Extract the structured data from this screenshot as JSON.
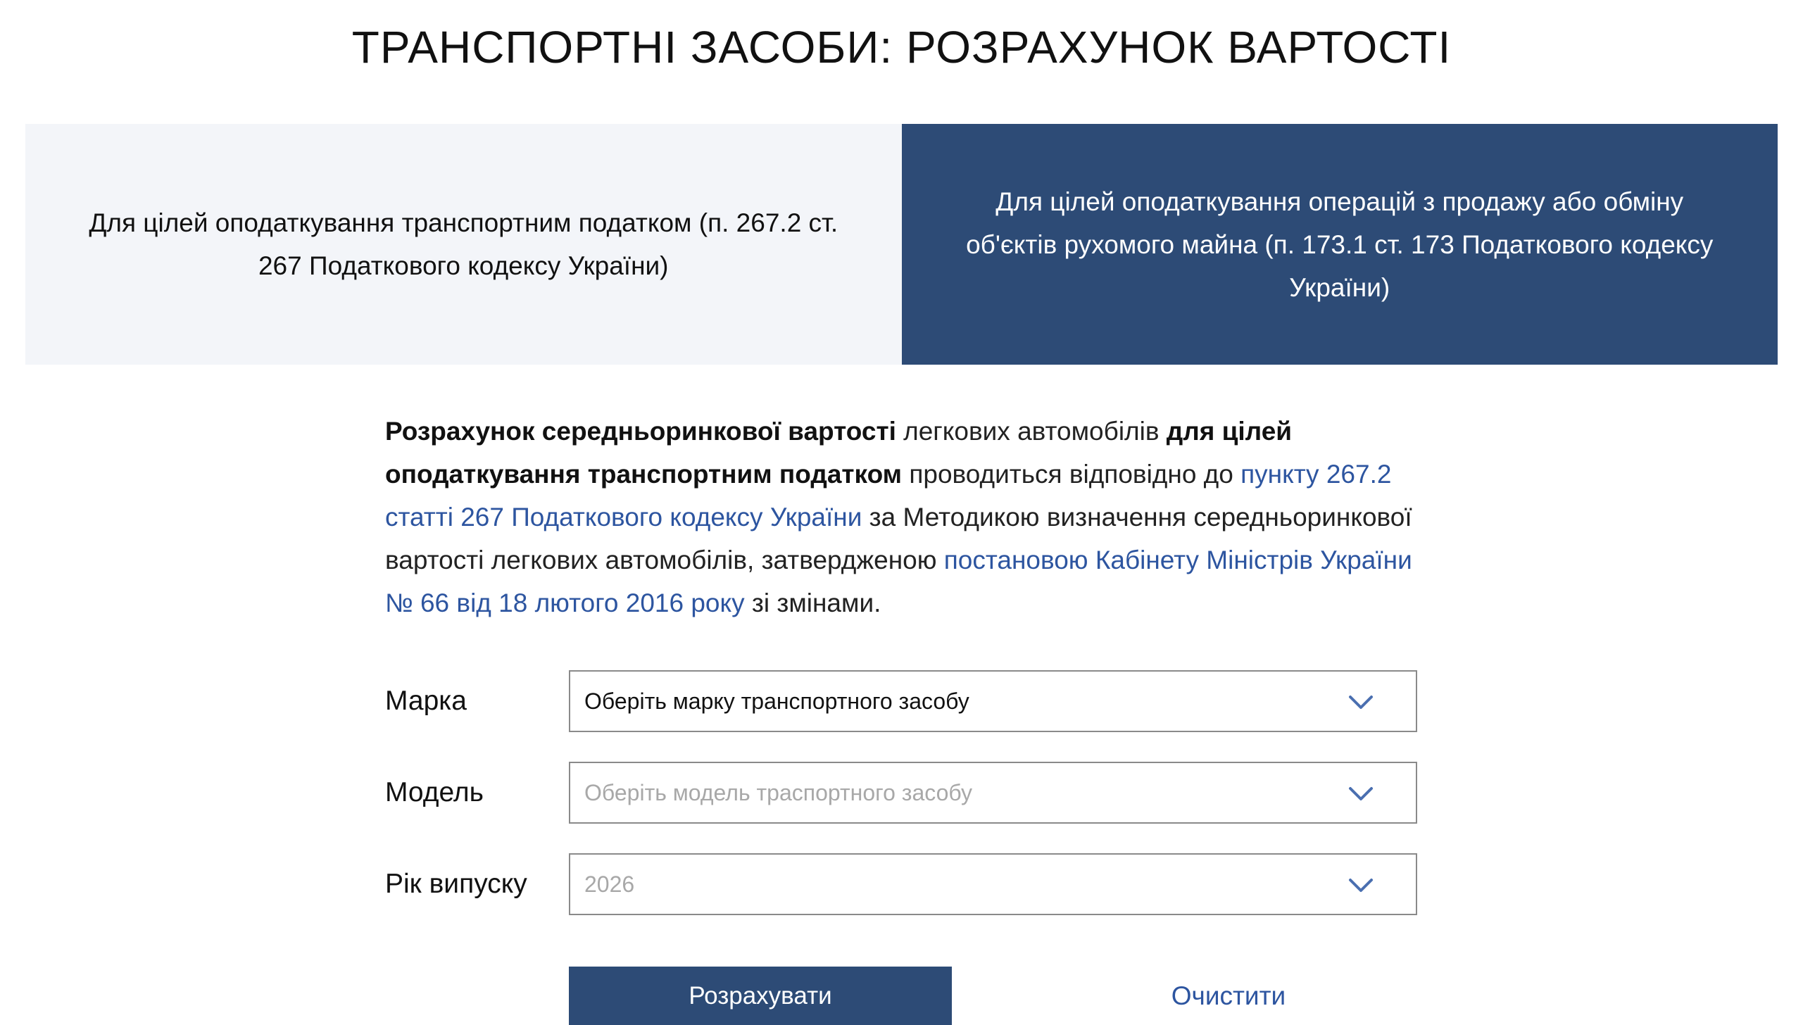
{
  "page": {
    "title": "ТРАНСПОРТНІ ЗАСОБИ: РОЗРАХУНОК ВАРТОСТІ"
  },
  "tabs": [
    {
      "label": "Для цілей оподаткування транспортним податком (п. 267.2 ст. 267 Податкового кодексу України)",
      "active": false
    },
    {
      "label": "Для цілей оподаткування операцій з продажу або обміну об'єктів рухомого майна (п. 173.1 ст. 173 Податкового кодексу України)",
      "active": true
    }
  ],
  "intro": {
    "bold_1": "Розрахунок середньоринкової вартості",
    "text_1": " легкових автомобілів ",
    "bold_2": "для цілей оподаткування транспортним податком",
    "text_2": " проводиться відповідно до ",
    "link_1": "пункту 267.2 статті 267 Податкового кодексу України",
    "text_3": " за Методикою визначення середньоринкової вартості легкових автомобілів, затвердженою ",
    "link_2": "постановою Кабінету Міністрів України № 66 від 18 лютого 2016 року",
    "text_4": " зі змінами."
  },
  "form": {
    "brand": {
      "label": "Марка",
      "value": "Оберіть марку транспортного засобу"
    },
    "model": {
      "label": "Модель",
      "placeholder": "Оберіть модель траспортного засобу"
    },
    "year": {
      "label": "Рік випуску",
      "placeholder": "2026"
    },
    "calculate_label": "Розрахувати",
    "clear_label": "Очистити"
  },
  "icons": {
    "select_arrow": "chevron-down-icon"
  },
  "colors": {
    "accent": "#2d4b76",
    "link": "#2d55a0",
    "inactive_tab_bg": "#f3f5f9",
    "chevron": "#4a6fb0"
  }
}
